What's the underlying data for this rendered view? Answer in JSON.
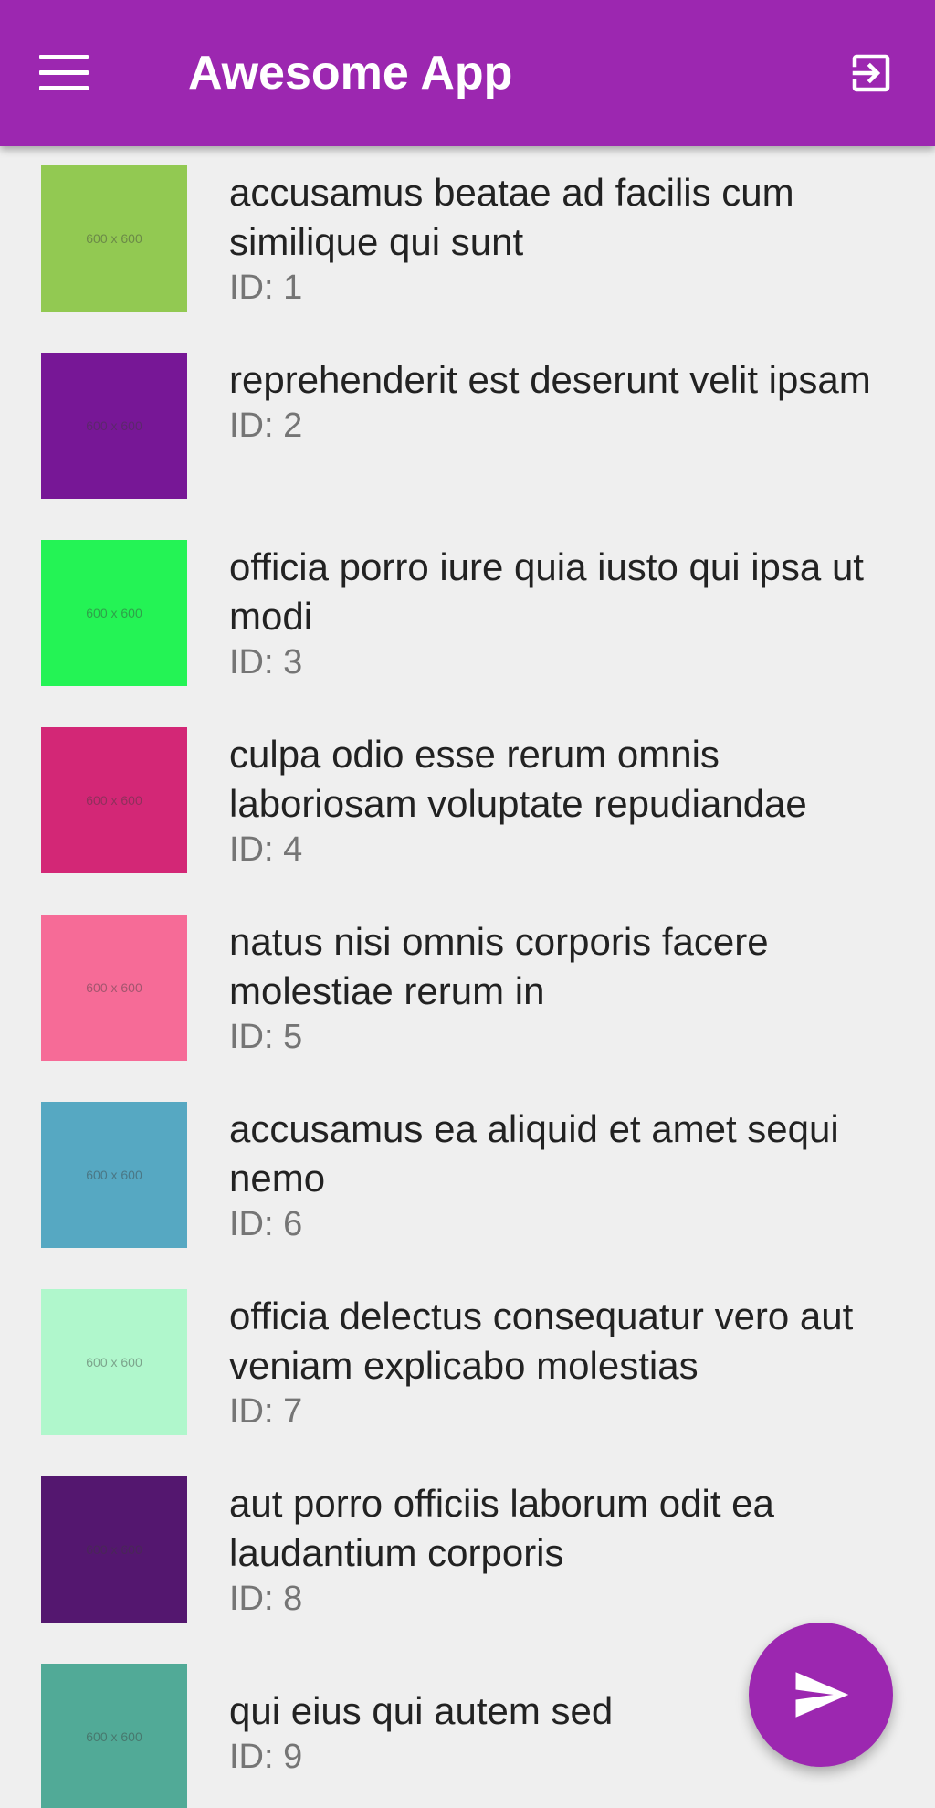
{
  "app": {
    "title": "Awesome App",
    "colors": {
      "primary": "#9c27b0",
      "background": "#efefef",
      "title_text": "#222222",
      "secondary_text": "#757575"
    },
    "menu_icon": "hamburger-menu-icon",
    "exit_icon": "exit-to-app-icon",
    "fab_icon": "send-icon"
  },
  "items": [
    {
      "title": "accusamus beatae ad facilis cum similique qui sunt",
      "id_text": "ID: 1",
      "thumb_label": "600 x 600",
      "thumb_color": "#92c952"
    },
    {
      "title": "reprehenderit est deserunt velit ipsam",
      "id_text": "ID: 2",
      "thumb_label": "600 x 600",
      "thumb_color": "#771796"
    },
    {
      "title": "officia porro iure quia iusto qui ipsa ut modi",
      "id_text": "ID: 3",
      "thumb_label": "600 x 600",
      "thumb_color": "#24f355"
    },
    {
      "title": "culpa odio esse rerum omnis laboriosam voluptate repudiandae",
      "id_text": "ID: 4",
      "thumb_label": "600 x 600",
      "thumb_color": "#d32776"
    },
    {
      "title": "natus nisi omnis corporis facere molestiae rerum in",
      "id_text": "ID: 5",
      "thumb_label": "600 x 600",
      "thumb_color": "#f66b97"
    },
    {
      "title": "accusamus ea aliquid et amet sequi nemo",
      "id_text": "ID: 6",
      "thumb_label": "600 x 600",
      "thumb_color": "#56a8c2"
    },
    {
      "title": "officia delectus consequatur vero aut veniam explicabo molestias",
      "id_text": "ID: 7",
      "thumb_label": "600 x 600",
      "thumb_color": "#b0f7cc"
    },
    {
      "title": "aut porro officiis laborum odit ea laudantium corporis",
      "id_text": "ID: 8",
      "thumb_label": "600 x 600",
      "thumb_color": "#54176f"
    },
    {
      "title": "qui eius qui autem sed",
      "id_text": "ID: 9",
      "thumb_label": "600 x 600",
      "thumb_color": "#51aa97"
    }
  ]
}
